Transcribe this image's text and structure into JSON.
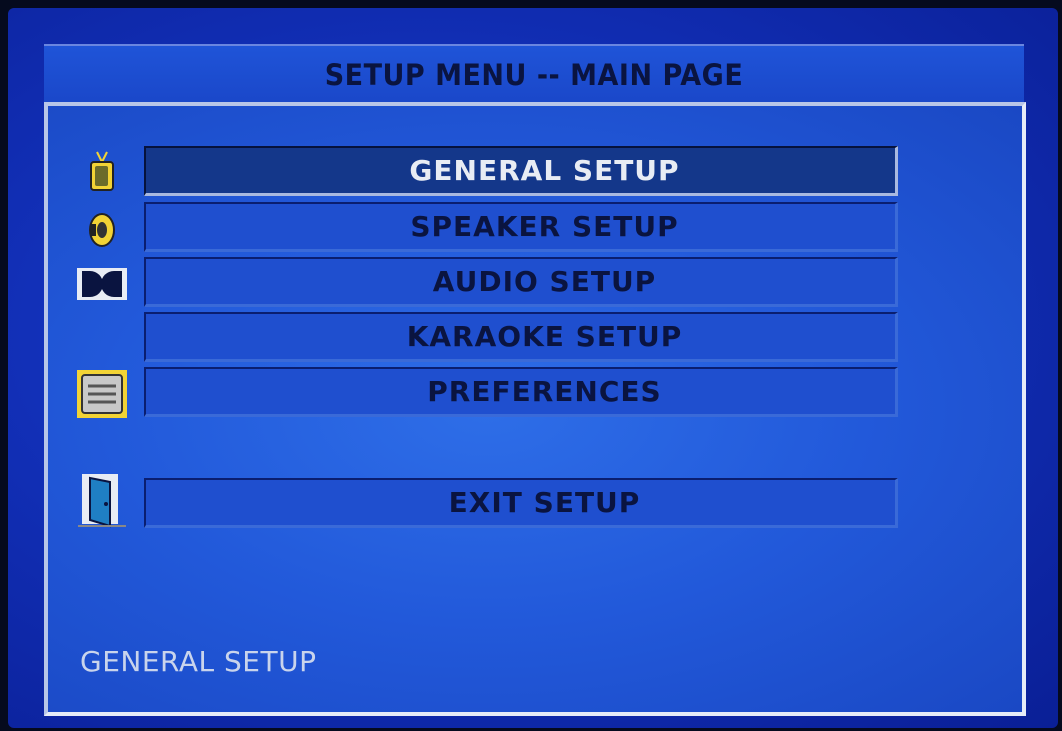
{
  "header": {
    "title": "SETUP MENU -- MAIN PAGE"
  },
  "menu": {
    "items": [
      {
        "label": "GENERAL SETUP",
        "icon": "tv-icon",
        "selected": true
      },
      {
        "label": "SPEAKER SETUP",
        "icon": "speaker-icon",
        "selected": false
      },
      {
        "label": "AUDIO SETUP",
        "icon": "dolby-icon",
        "selected": false
      },
      {
        "label": "KARAOKE SETUP",
        "icon": "",
        "selected": false
      },
      {
        "label": "PREFERENCES",
        "icon": "preferences-icon",
        "selected": false
      }
    ],
    "exit": {
      "label": "EXIT SETUP",
      "icon": "exit-door-icon"
    }
  },
  "status": {
    "text": "GENERAL SETUP"
  },
  "colors": {
    "background": "#2259da",
    "selected": "#14378a",
    "text_dark": "#0a1440",
    "text_light": "#e8ecf4",
    "icon_yellow": "#f2d335"
  }
}
